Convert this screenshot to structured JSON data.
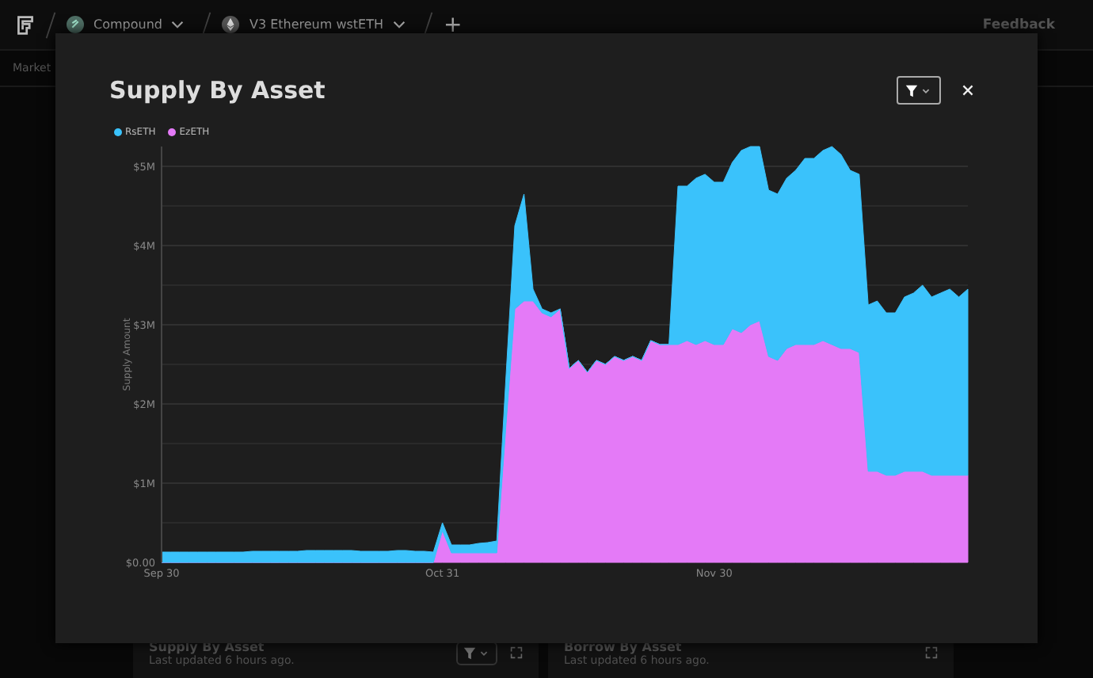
{
  "topbar": {
    "breadcrumbs": [
      {
        "label": "Compound",
        "kind": "coin"
      },
      {
        "label": "V3 Ethereum wstETH",
        "kind": "eth"
      }
    ],
    "add": "+",
    "feedback": "Feedback"
  },
  "subnav": {
    "label": "Market"
  },
  "cards": [
    {
      "title": "Supply By Asset",
      "updated": "Last updated 6 hours ago.",
      "filter": true
    },
    {
      "title": "Borrow By Asset",
      "updated": "Last updated 6 hours ago.",
      "filter": false
    }
  ],
  "modal": {
    "title": "Supply By Asset",
    "chart_data": {
      "type": "area",
      "stacked": true,
      "grid": true,
      "ylabel": "Supply Amount",
      "categories": [
        "Sep 30",
        null,
        null,
        null,
        null,
        null,
        null,
        null,
        null,
        null,
        null,
        null,
        null,
        null,
        null,
        null,
        null,
        null,
        null,
        null,
        null,
        null,
        null,
        null,
        null,
        null,
        null,
        null,
        null,
        null,
        null,
        "Oct 31",
        null,
        null,
        null,
        null,
        null,
        null,
        null,
        null,
        null,
        null,
        null,
        null,
        null,
        null,
        null,
        null,
        null,
        null,
        null,
        null,
        null,
        null,
        null,
        null,
        null,
        null,
        null,
        null,
        null,
        "Nov 30",
        null,
        null,
        null,
        null,
        null,
        null,
        null,
        null,
        null,
        null,
        null,
        null,
        null,
        null,
        null,
        null,
        null,
        null,
        null,
        null,
        null,
        null,
        null,
        null,
        null,
        null,
        null,
        null
      ],
      "series": [
        {
          "name": "RsETH",
          "color": "#3ac2fb",
          "values": [
            0.13,
            0.13,
            0.13,
            0.13,
            0.13,
            0.13,
            0.13,
            0.13,
            0.13,
            0.13,
            0.14,
            0.14,
            0.14,
            0.14,
            0.14,
            0.14,
            0.15,
            0.15,
            0.15,
            0.15,
            0.15,
            0.15,
            0.14,
            0.14,
            0.14,
            0.14,
            0.15,
            0.15,
            0.14,
            0.14,
            0.13,
            0.1,
            0.1,
            0.1,
            0.1,
            0.12,
            0.13,
            0.15,
            0.6,
            1.05,
            1.35,
            0.15,
            0.05,
            0.05,
            0,
            0,
            0,
            0,
            0,
            0,
            0,
            0,
            0,
            0,
            0,
            0,
            0,
            2.0,
            1.95,
            2.1,
            2.1,
            2.05,
            2.05,
            2.1,
            2.3,
            2.25,
            2.2,
            2.1,
            2.1,
            2.15,
            2.2,
            2.35,
            2.35,
            2.4,
            2.5,
            2.45,
            2.25,
            2.25,
            2.1,
            2.15,
            2.05,
            2.05,
            2.2,
            2.25,
            2.35,
            2.25,
            2.3,
            2.35,
            2.25,
            2.35
          ]
        },
        {
          "name": "EzETH",
          "color": "#e47af7",
          "values": [
            0,
            0,
            0,
            0,
            0,
            0,
            0,
            0,
            0,
            0,
            0,
            0,
            0,
            0,
            0,
            0,
            0,
            0,
            0,
            0,
            0,
            0,
            0,
            0,
            0,
            0,
            0,
            0,
            0,
            0,
            0,
            0.4,
            0.12,
            0.12,
            0.12,
            0.12,
            0.12,
            0.12,
            1.7,
            3.2,
            3.3,
            3.3,
            3.15,
            3.1,
            3.2,
            2.45,
            2.55,
            2.4,
            2.55,
            2.5,
            2.6,
            2.55,
            2.6,
            2.55,
            2.8,
            2.75,
            2.75,
            2.75,
            2.8,
            2.75,
            2.8,
            2.75,
            2.75,
            2.95,
            2.9,
            3.0,
            3.05,
            2.6,
            2.55,
            2.7,
            2.75,
            2.75,
            2.75,
            2.8,
            2.75,
            2.7,
            2.7,
            2.65,
            1.15,
            1.15,
            1.1,
            1.1,
            1.15,
            1.15,
            1.15,
            1.1,
            1.1,
            1.1,
            1.1,
            1.1
          ]
        }
      ],
      "ylim": [
        0,
        5.25
      ],
      "yticks": [
        {
          "value": 0,
          "label": "$0.00"
        },
        {
          "value": 1,
          "label": "$1M"
        },
        {
          "value": 2,
          "label": "$2M"
        },
        {
          "value": 3,
          "label": "$3M"
        },
        {
          "value": 4,
          "label": "$4M"
        },
        {
          "value": 5,
          "label": "$5M"
        }
      ]
    }
  }
}
